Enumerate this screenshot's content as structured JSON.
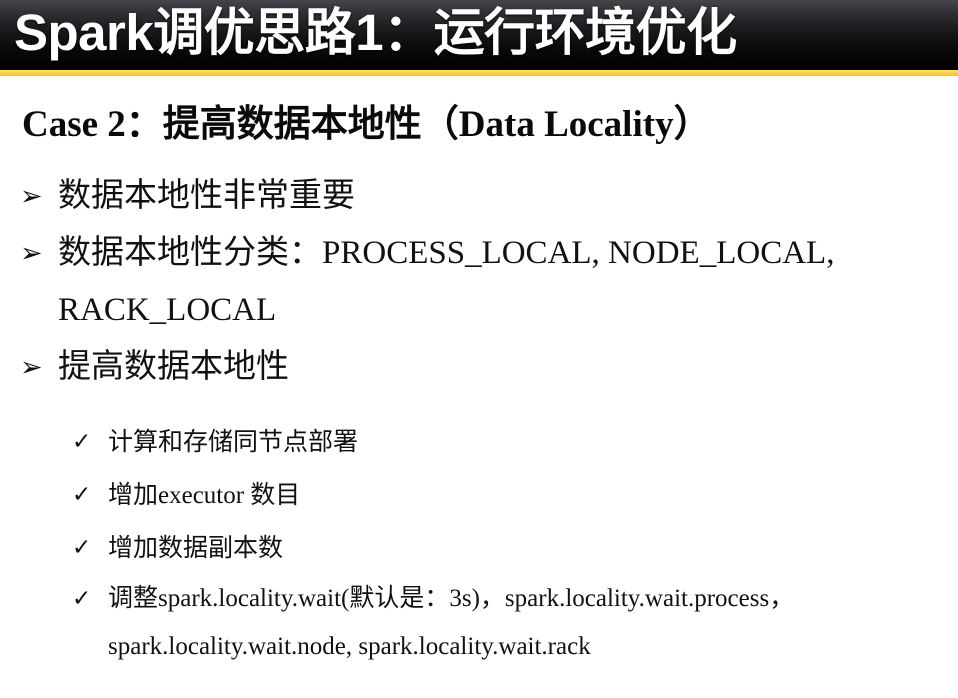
{
  "slide": {
    "title": "Spark调优思路1：运行环境优化",
    "accent_color": "#F6D243",
    "title_bar_color": "#000000",
    "title_text_color": "#FFFFFF",
    "body_background": "#FFFFFF",
    "body_text_color": "#111111"
  },
  "content": {
    "heading": "Case 2：提高数据本地性（Data Locality）",
    "bullets": [
      {
        "marker": "➢",
        "lines": [
          "数据本地性非常重要"
        ]
      },
      {
        "marker": "➢",
        "lines": [
          "数据本地性分类：PROCESS_LOCAL, NODE_LOCAL,",
          "RACK_LOCAL"
        ]
      },
      {
        "marker": "➢",
        "lines": [
          "提高数据本地性"
        ]
      }
    ],
    "sub_bullets": [
      {
        "marker": "✓",
        "lines": [
          "计算和存储同节点部署"
        ]
      },
      {
        "marker": "✓",
        "lines": [
          "增加executor 数目"
        ]
      },
      {
        "marker": "✓",
        "lines": [
          "增加数据副本数"
        ]
      },
      {
        "marker": "✓",
        "lines": [
          "调整spark.locality.wait(默认是：3s)，spark.locality.wait.process，",
          "spark.locality.wait.node, spark.locality.wait.rack"
        ]
      }
    ]
  }
}
